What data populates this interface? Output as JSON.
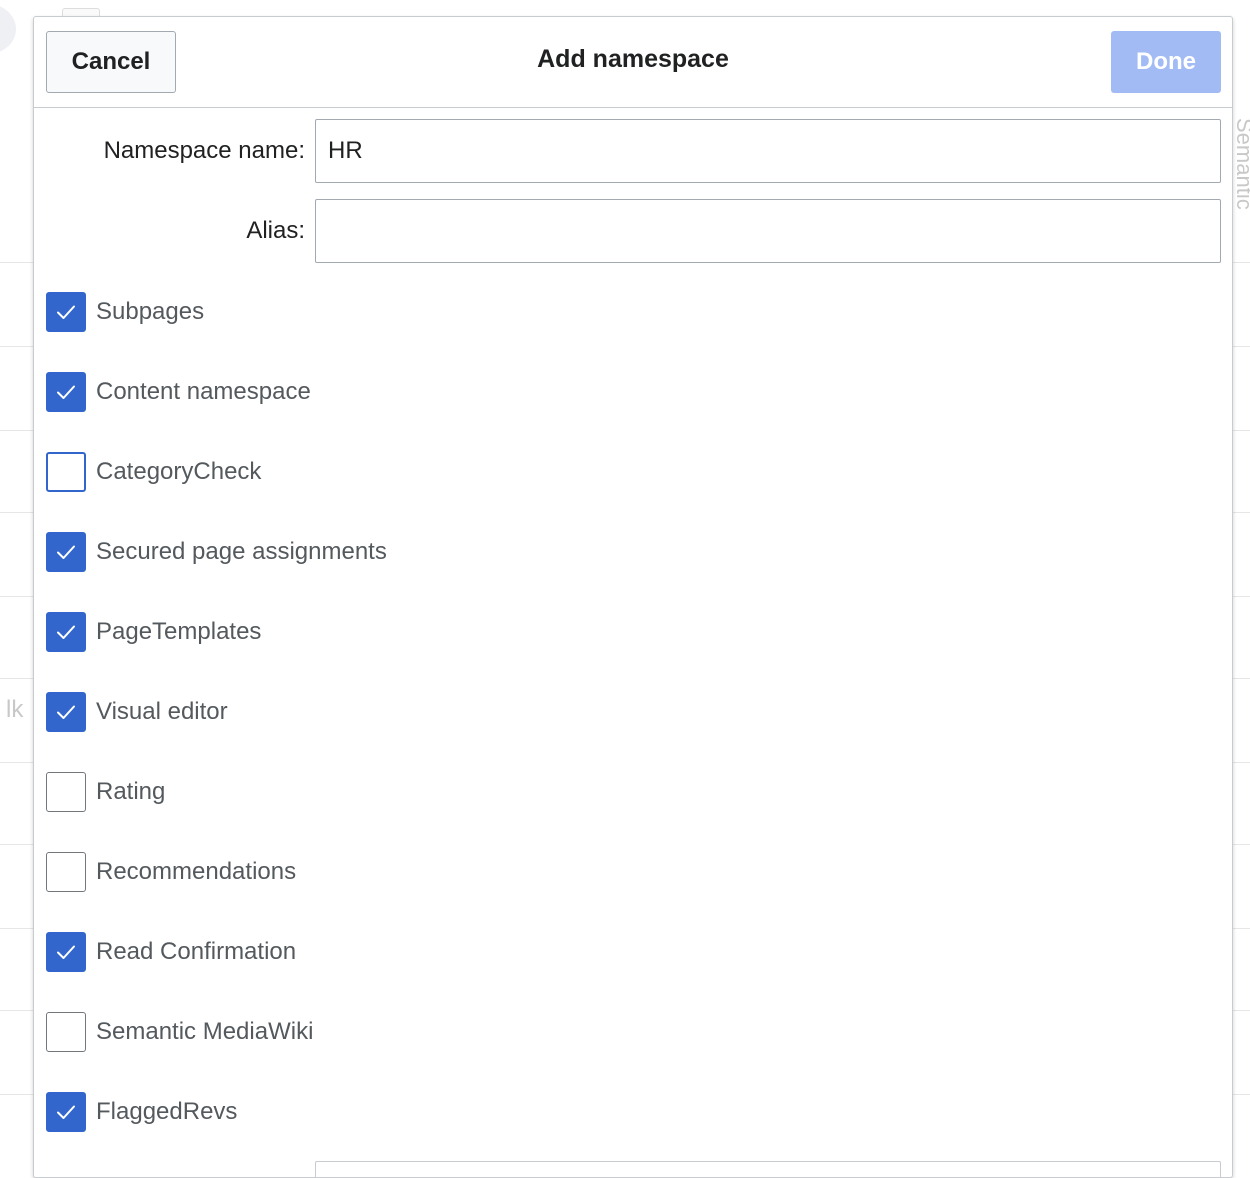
{
  "dialog": {
    "title": "Add namespace",
    "cancel_label": "Cancel",
    "done_label": "Done"
  },
  "fields": {
    "namespace_name": {
      "label": "Namespace name:",
      "value": "HR"
    },
    "alias": {
      "label": "Alias:",
      "value": ""
    }
  },
  "options": [
    {
      "label": "Subpages",
      "checked": true
    },
    {
      "label": "Content namespace",
      "checked": true
    },
    {
      "label": "CategoryCheck",
      "checked": false,
      "focused": true
    },
    {
      "label": "Secured page assignments",
      "checked": true
    },
    {
      "label": "PageTemplates",
      "checked": true
    },
    {
      "label": "Visual editor",
      "checked": true
    },
    {
      "label": "Rating",
      "checked": false
    },
    {
      "label": "Recommendations",
      "checked": false
    },
    {
      "label": "Read Confirmation",
      "checked": true
    },
    {
      "label": "Semantic MediaWiki",
      "checked": false
    },
    {
      "label": "FlaggedRevs",
      "checked": true
    }
  ],
  "background": {
    "side_text": "lk",
    "vertical_text": "Semantic"
  },
  "colors": {
    "accent": "#3366cc",
    "done_disabled": "#a3bbf5",
    "border": "#a2a9b1"
  }
}
